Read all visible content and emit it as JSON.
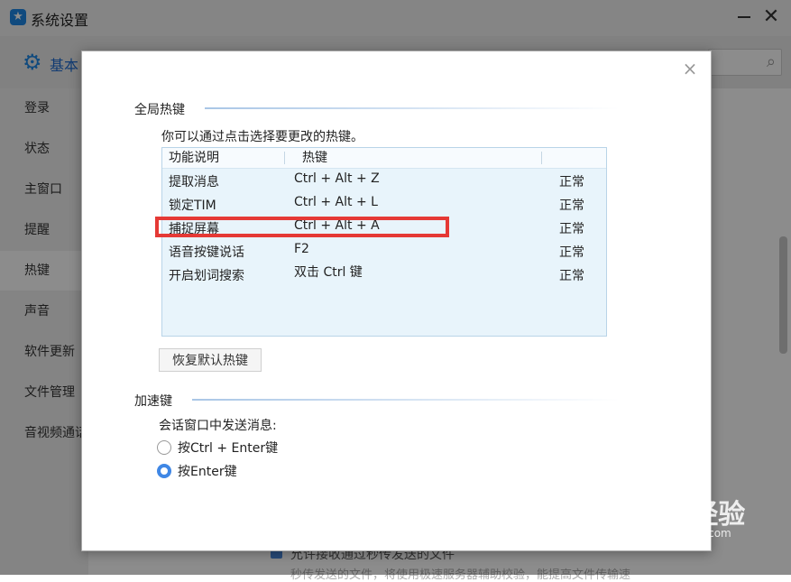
{
  "window": {
    "title": "系统设置",
    "app_icon": "qq-star-icon",
    "minimize": "—",
    "close": "✕"
  },
  "toolbar": {
    "section_icon": "gear-icon",
    "section_label": "基本",
    "search_icon": "search-icon"
  },
  "sidebar": {
    "items": [
      {
        "label": "登录"
      },
      {
        "label": "状态"
      },
      {
        "label": "主窗口"
      },
      {
        "label": "提醒"
      },
      {
        "label": "热键"
      },
      {
        "label": "声音"
      },
      {
        "label": "软件更新"
      },
      {
        "label": "文件管理"
      },
      {
        "label": "音视频通话"
      }
    ],
    "active_index": 4
  },
  "background": {
    "file_option_label": "允许接收通过秒传发送的文件",
    "file_option_desc": "秒传发送的文件，将使用极速服务器辅助校验，能提高文件传输速"
  },
  "dialog": {
    "close": "×",
    "global_hotkeys": {
      "title": "全局热键",
      "hint": "你可以通过点击选择要更改的热键。",
      "columns": [
        "功能说明",
        "热键"
      ],
      "rows": [
        {
          "function": "提取消息",
          "hotkey": "Ctrl + Alt + Z",
          "status": "正常"
        },
        {
          "function": "锁定TIM",
          "hotkey": "Ctrl + Alt + L",
          "status": "正常"
        },
        {
          "function": "捕捉屏幕",
          "hotkey": "Ctrl + Alt + A",
          "status": "正常"
        },
        {
          "function": "语音按键说话",
          "hotkey": "F2",
          "status": "正常"
        },
        {
          "function": "开启划词搜索",
          "hotkey": "双击 Ctrl 键",
          "status": "正常"
        }
      ],
      "highlighted_row": 2,
      "reset_button": "恢复默认热键"
    },
    "accelerators": {
      "title": "加速键",
      "send_label": "会话窗口中发送消息:",
      "options": [
        {
          "label": "按Ctrl + Enter键",
          "selected": false
        },
        {
          "label": "按Enter键",
          "selected": true
        }
      ]
    }
  },
  "colors": {
    "accent": "#3f87e5",
    "highlight": "#e53935",
    "table_bg": "#e8f4fb"
  },
  "watermark": {
    "text": "Baidu经验",
    "sub": "jingyan.baidu.com"
  }
}
